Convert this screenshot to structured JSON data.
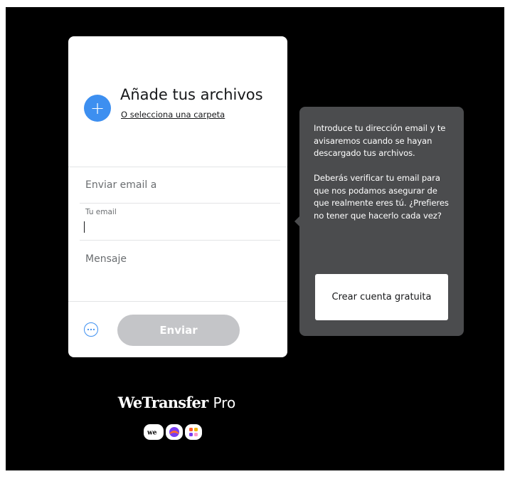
{
  "upload": {
    "title": "Añade tus archivos",
    "folder_link": "O selecciona una carpeta",
    "add_icon": "plus-icon"
  },
  "form": {
    "to_placeholder": "Enviar email a",
    "email_label": "Tu email",
    "email_value": "",
    "message_placeholder": "Mensaje",
    "send_label": "Enviar",
    "options_icon": "more-options-icon"
  },
  "tooltip": {
    "paragraph1": "Introduce tu dirección email y te avisaremos cuando se hayan descargado tus archivos.",
    "paragraph2": "Deberás verificar tu email para que nos podamos asegurar de que realmente eres tú. ¿Prefieres no tener que hacerlo cada vez?",
    "button_label": "Crear cuenta gratuita"
  },
  "brand": {
    "name": "WeTransfer",
    "suffix": "Pro",
    "app_icons": [
      "wetransfer-app-icon",
      "collect-app-icon",
      "paste-app-icon"
    ]
  },
  "colors": {
    "accent": "#3d8ff0",
    "background": "#000000",
    "tooltip": "#4b4c4e",
    "disabled_button": "#c4c5c8"
  }
}
